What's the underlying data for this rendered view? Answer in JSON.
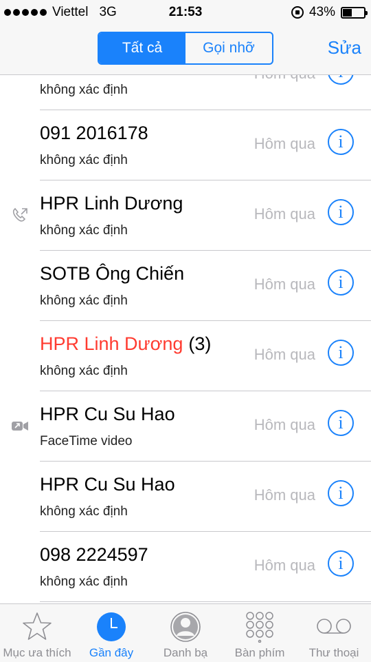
{
  "status": {
    "carrier": "Viettel",
    "network": "3G",
    "time": "21:53",
    "battery_text": "43%",
    "battery_level": 0.43
  },
  "nav": {
    "segments": [
      "Tất cả",
      "Gọi nhỡ"
    ],
    "selected_segment": "Tất cả",
    "edit_label": "Sửa"
  },
  "calls": [
    {
      "name": "",
      "detail": "không xác định",
      "date": "Hôm qua",
      "missed": false,
      "count": "",
      "type_icon": ""
    },
    {
      "name": "091 2016178",
      "detail": "không xác định",
      "date": "Hôm qua",
      "missed": false,
      "count": "",
      "type_icon": ""
    },
    {
      "name": "HPR Linh Dương",
      "detail": "không xác định",
      "date": "Hôm qua",
      "missed": false,
      "count": "",
      "type_icon": "outgoing-call-icon"
    },
    {
      "name": "SOTB Ông Chiến",
      "detail": "không xác định",
      "date": "Hôm qua",
      "missed": false,
      "count": "",
      "type_icon": ""
    },
    {
      "name": "HPR Linh Dương",
      "detail": "không xác định",
      "date": "Hôm qua",
      "missed": true,
      "count": "(3)",
      "type_icon": ""
    },
    {
      "name": "HPR Cu Su Hao",
      "detail": "FaceTime video",
      "date": "Hôm qua",
      "missed": false,
      "count": "",
      "type_icon": "facetime-outgoing-icon"
    },
    {
      "name": "HPR Cu Su Hao",
      "detail": "không xác định",
      "date": "Hôm qua",
      "missed": false,
      "count": "",
      "type_icon": ""
    },
    {
      "name": "098 2224597",
      "detail": "không xác định",
      "date": "Hôm qua",
      "missed": false,
      "count": "",
      "type_icon": ""
    }
  ],
  "info_glyph": "i",
  "tabs": [
    {
      "label": "Mục ưa thích",
      "icon": "star-icon",
      "active": false
    },
    {
      "label": "Gần đây",
      "icon": "clock-icon",
      "active": true
    },
    {
      "label": "Danh bạ",
      "icon": "contacts-icon",
      "active": false
    },
    {
      "label": "Bàn phím",
      "icon": "keypad-icon",
      "active": false
    },
    {
      "label": "Thư thoại",
      "icon": "voicemail-icon",
      "active": false
    }
  ],
  "colors": {
    "accent": "#1a82fb",
    "missed": "#ff3b30",
    "date": "#b8b8bc"
  }
}
